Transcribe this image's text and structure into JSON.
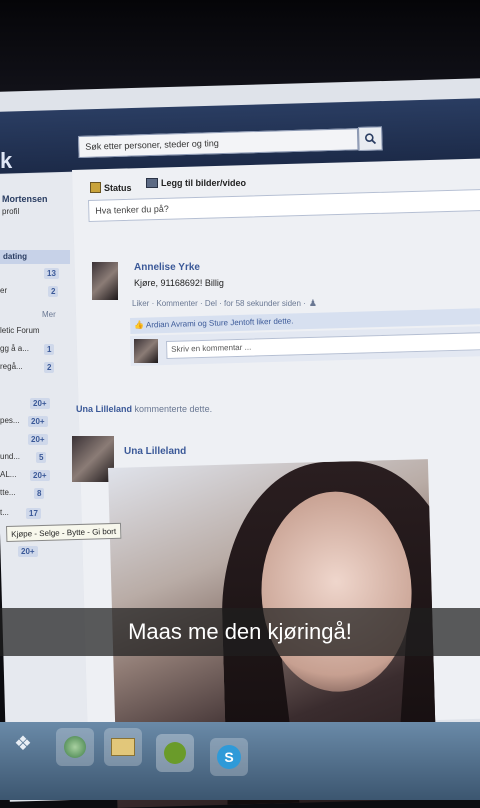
{
  "header": {
    "logo": "k",
    "search_placeholder": "Søk etter personer, steder og ting"
  },
  "sidebar": {
    "profile_name": "Mortensen",
    "profile_link": "profil",
    "section_heading": "dating",
    "items": [
      {
        "label": "",
        "count": "13"
      },
      {
        "label": "er",
        "count": "2"
      },
      {
        "label": "Mer",
        "count": ""
      },
      {
        "label": "letic Forum",
        "count": ""
      },
      {
        "label": "gg å a...",
        "count": "1"
      },
      {
        "label": "regå...",
        "count": "2"
      },
      {
        "label": "",
        "count": "20+"
      },
      {
        "label": "pes...",
        "count": "20+"
      },
      {
        "label": "",
        "count": "20+"
      },
      {
        "label": "und...",
        "count": "5"
      },
      {
        "label": "AL...",
        "count": "20+"
      },
      {
        "label": "tte...",
        "count": "8"
      },
      {
        "label": "t...",
        "count": "17"
      },
      {
        "label": "",
        "count": "20+"
      }
    ]
  },
  "composer": {
    "tab_status": "Status",
    "tab_photo": "Legg til bilder/video",
    "placeholder": "Hva tenker du på?"
  },
  "post": {
    "author": "Annelise Yrke",
    "text": "Kjøre, 91168692! Billig",
    "actions": "Liker · Kommenter · Del · for 58 sekunder siden ·",
    "likes_text": "Ardian Avrami og Sture Jentoft liker dette.",
    "comment_placeholder": "Skriv en kommentar ..."
  },
  "activity": {
    "actor": "Una Lilleland",
    "action_text": "kommenterte dette."
  },
  "photo_post": {
    "author": "Una Lilleland"
  },
  "tooltip": "Kjøpe - Selge - Bytte - Gi bort",
  "caption": "Maas me den kjøringå!",
  "colors": {
    "facebook_blue": "#3b5998",
    "top_bar": "#2a3d62"
  }
}
